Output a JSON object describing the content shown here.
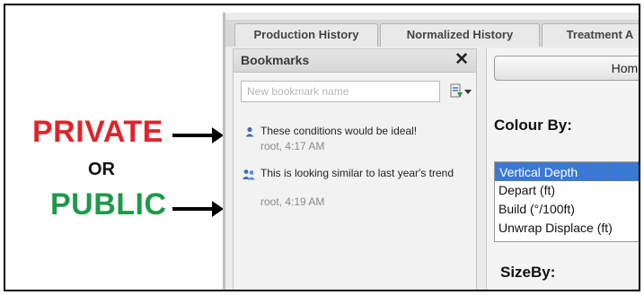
{
  "annotations": {
    "private": "PRIVATE",
    "or": "OR",
    "public": "PUBLIC"
  },
  "tabs": [
    {
      "label": "Production History"
    },
    {
      "label": "Normalized History"
    },
    {
      "label": "Treatment A"
    }
  ],
  "bookmarks_panel": {
    "title": "Bookmarks",
    "close_label": "✕",
    "input_placeholder": "New bookmark name",
    "items": [
      {
        "icon": "single-user-icon",
        "text": "These conditions would be ideal!",
        "meta": "root, 4:17 AM"
      },
      {
        "icon": "group-users-icon",
        "text": "This is looking similar to last year's trend",
        "meta": "root, 4:19 AM"
      }
    ]
  },
  "right_panel": {
    "home_button": "Home",
    "colour_by_label": "Colour By:",
    "colour_options": [
      "Vertical Depth",
      "Depart (ft)",
      "Build (°/100ft)",
      "Unwrap Displace (ft)"
    ],
    "selected_option": "Vertical Depth",
    "size_by_label": "SizeBy:"
  },
  "colors": {
    "private": "#e0242a",
    "public": "#1c9a4a",
    "selection": "#3a78d6"
  }
}
